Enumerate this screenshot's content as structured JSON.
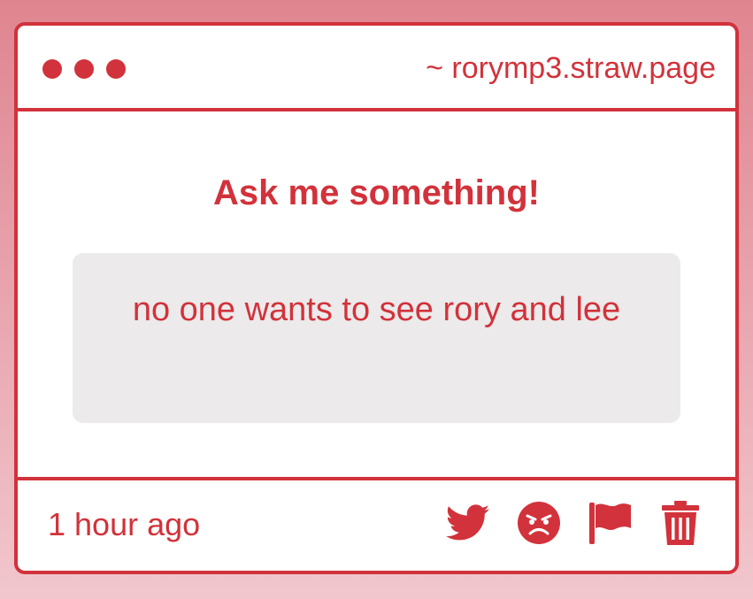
{
  "window": {
    "url": "~ rorymp3.straw.page",
    "accent_color": "#d2323b"
  },
  "main": {
    "heading": "Ask me something!",
    "question": "no one wants to see rory and lee"
  },
  "footer": {
    "timestamp": "1 hour ago",
    "actions": [
      "twitter-icon",
      "angry-face-icon",
      "flag-icon",
      "trash-icon"
    ]
  }
}
